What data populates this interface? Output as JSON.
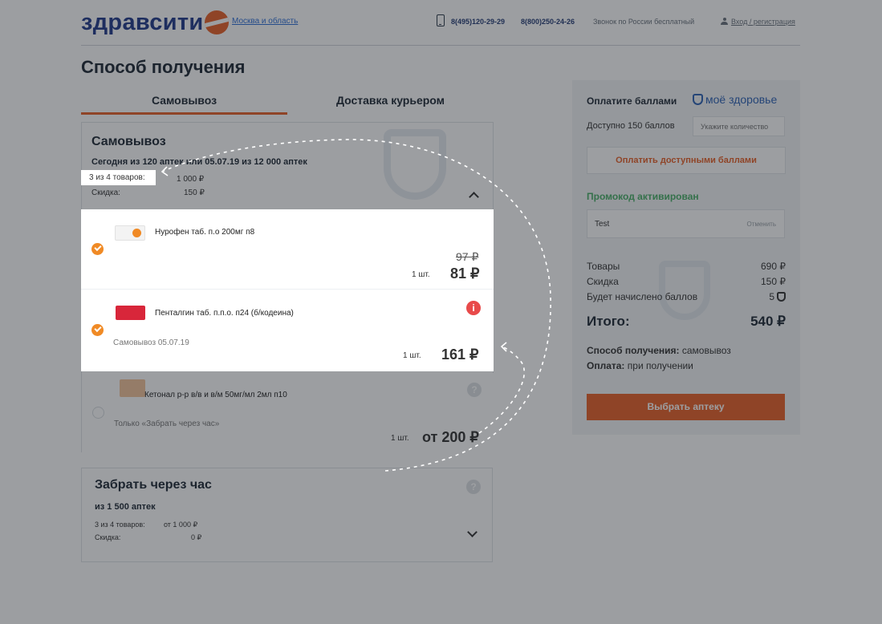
{
  "header": {
    "logo_text": "здравсити",
    "city": "Москва и область",
    "phone1": "8(495)120-29-29",
    "phone2": "8(800)250-24-26",
    "free_call": "Звонок по России бесплатный",
    "login": "Вход / регистрация"
  },
  "page_title": "Способ получения",
  "tabs": {
    "pickup": "Самовывоз",
    "courier": "Доставка курьером"
  },
  "pickup": {
    "title": "Самовывоз",
    "subtitle": "Сегодня из 120 аптек или 05.07.19 из 12 000 аптек",
    "count_label": "3 из 4 товаров:",
    "count_value": "1 000 ₽",
    "discount_label": "Скидка:",
    "discount_value": "150 ₽",
    "products": [
      {
        "name": "Нурофен таб. п.о 200мг п8",
        "qty": "1 шт.",
        "old_price": "97 ₽",
        "price": "81 ₽",
        "note": ""
      },
      {
        "name": "Пенталгин таб. п.п.о. п24 (б/кодеина)",
        "qty": "1 шт.",
        "old_price": "",
        "price": "161 ₽",
        "note": "Самовывоз 05.07.19",
        "info_mark": "i"
      },
      {
        "name": "Кетонал р-р в/в и в/м 50мг/мл 2мл п10",
        "qty": "1 шт.",
        "old_price": "",
        "price": "от 200 ₽",
        "note": "Только «Забрать через час»",
        "help_mark": "?"
      }
    ]
  },
  "hour": {
    "title": "Забрать через час",
    "subtitle": "из 1 500 аптек",
    "count_label": "3 из 4 товаров:",
    "count_value": "от 1 000 ₽",
    "discount_label": "Скидка:",
    "discount_value": "0 ₽",
    "help_mark": "?"
  },
  "sidebar": {
    "pay_title": "Оплатите баллами",
    "brand": "моё здоровье",
    "available": "Доступно 150 баллов",
    "points_placeholder": "Укажите количество",
    "pay_button": "Оплатить доступными баллами",
    "promo_title": "Промокод активирован",
    "promo_code": "Test",
    "promo_cancel": "Отменить",
    "summary": [
      {
        "label": "Товары",
        "value": "690 ₽"
      },
      {
        "label": "Скидка",
        "value": "150 ₽"
      },
      {
        "label": "Будет начислено баллов",
        "value": "5"
      }
    ],
    "total_label": "Итого:",
    "total_value": "540 ₽",
    "method_label": "Способ получения:",
    "method_value": "самовывоз",
    "payment_label": "Оплата:",
    "payment_value": "при получении",
    "choose_button": "Выбрать аптеку"
  },
  "colors": {
    "accent": "#e9622a",
    "brand_blue": "#233a8c",
    "promo_green": "#4bb069",
    "check_orange": "#f08a25",
    "info_red": "#e84a4a"
  },
  "icons": [
    "phone-icon",
    "user-icon",
    "shield-icon",
    "check-icon",
    "info-icon",
    "help-icon",
    "chevron-up-icon",
    "chevron-down-icon"
  ]
}
